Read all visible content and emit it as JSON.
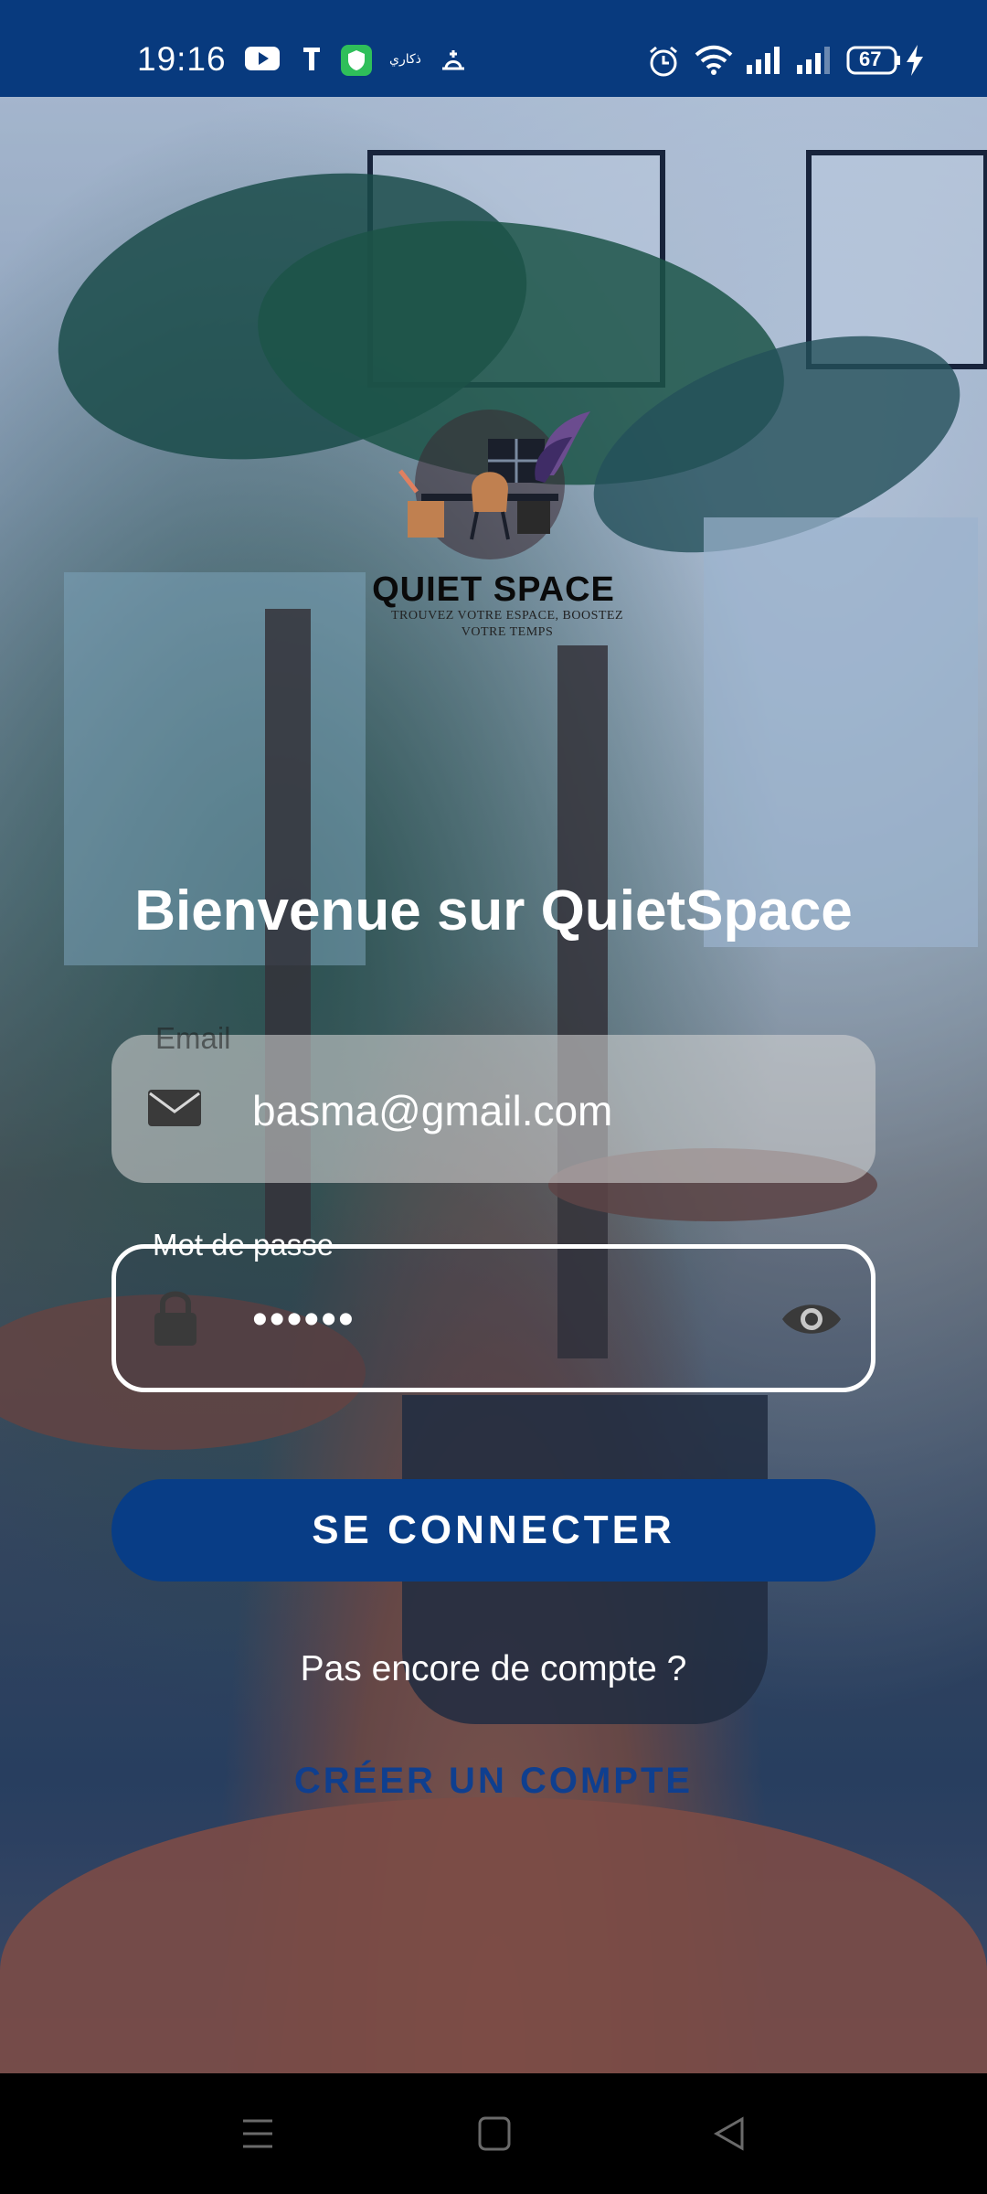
{
  "status_bar": {
    "time": "19:16",
    "battery": "67",
    "left_icons": [
      "youtube-icon",
      "t-icon",
      "shield-app-icon",
      "adkar-icon",
      "prayer-icon"
    ],
    "right_icons": [
      "alarm-icon",
      "wifi-icon",
      "signal-icon",
      "signal-icon-2",
      "battery-icon",
      "charging-icon"
    ]
  },
  "logo": {
    "title": "QUIET SPACE",
    "tagline_line1": "TROUVEZ VOTRE ESPACE, BOOSTEZ",
    "tagline_line2": "VOTRE TEMPS"
  },
  "welcome": "Bienvenue sur QuietSpace",
  "email": {
    "label": "Email",
    "value": "basma@gmail.com",
    "icon": "mail-icon"
  },
  "password": {
    "label": "Mot de passe",
    "value": "••••••",
    "icon": "lock-icon",
    "toggle_icon": "eye-icon"
  },
  "login_button": "SE CONNECTER",
  "no_account_text": "Pas encore de compte ?",
  "create_account": "CRÉER UN COMPTE",
  "colors": {
    "primary": "#083d86",
    "status_bar": "#083a7e",
    "link": "#0f3f8f"
  }
}
